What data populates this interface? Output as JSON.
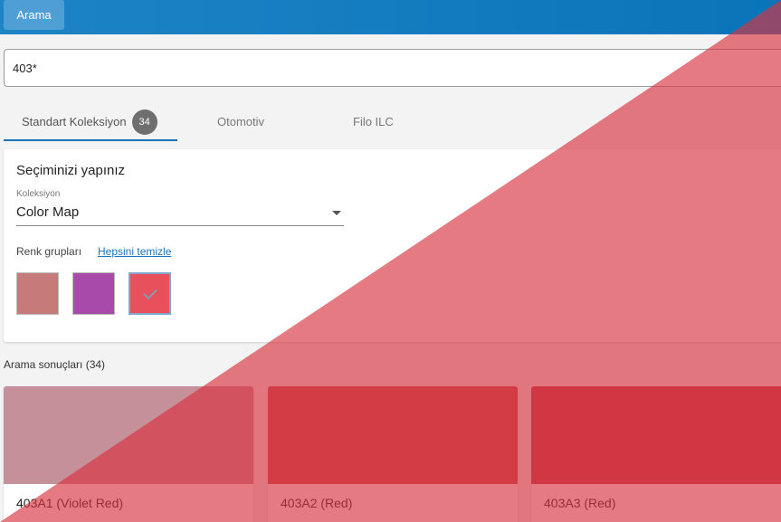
{
  "topbar": {
    "search_button": "Arama",
    "color": "#0a74b9"
  },
  "search": {
    "value": "403*"
  },
  "tabs": [
    {
      "label": "Standart Koleksiyon",
      "badge": "34",
      "active": true
    },
    {
      "label": "Otomotiv",
      "active": false
    },
    {
      "label": "Filo ILC",
      "active": false
    }
  ],
  "filters": {
    "title": "Seçiminizi yapınız",
    "collection_label": "Koleksiyon",
    "collection_value": "Color Map",
    "groups_label": "Renk grupları",
    "clear_all": "Hepsini temizle",
    "swatches": [
      {
        "color": "#c77a7a",
        "selected": false
      },
      {
        "color": "#a74aaa",
        "selected": false
      },
      {
        "color": "#e8515b",
        "selected": true
      }
    ]
  },
  "results": {
    "title": "Arama sonuçları (34)",
    "cards": [
      {
        "label": "403A1 (Violet Red)",
        "color": "#c6909a"
      },
      {
        "label": "403A2 (Red)",
        "color": "#c84a52"
      },
      {
        "label": "403A3 (Red)",
        "color": "#c2404a"
      }
    ]
  },
  "overlay": {
    "color": "#d9333f",
    "opacity": 0.65
  }
}
